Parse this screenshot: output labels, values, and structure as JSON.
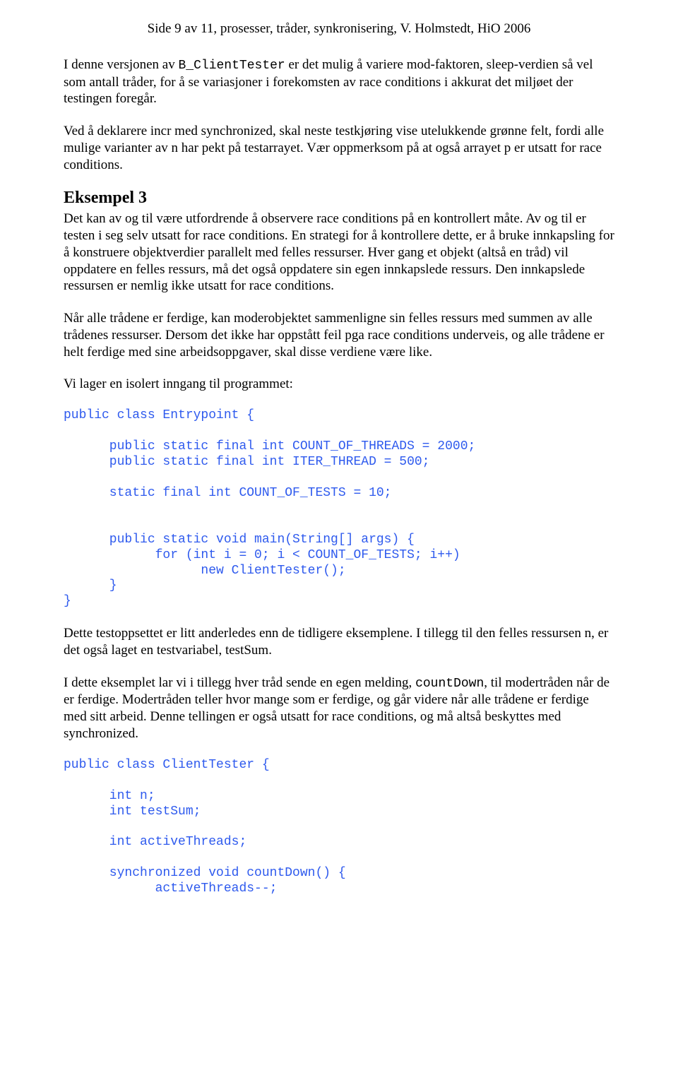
{
  "header": "Side 9 av 11, prosesser, tråder, synkronisering, V. Holmstedt, HiO 2006",
  "para1_a": "I denne versjonen av ",
  "para1_code": "B_ClientTester",
  "para1_b": " er det mulig å variere mod-faktoren, sleep-verdien så vel som antall tråder, for å se variasjoner i forekomsten av race conditions i akkurat det miljøet der testingen foregår.",
  "para2": "Ved å deklarere incr med synchronized, skal neste testkjøring vise utelukkende grønne felt, fordi alle mulige varianter av n har pekt på testarrayet. Vær oppmerksom på at også arrayet p er utsatt for race conditions.",
  "heading_ex3": "Eksempel 3",
  "para3": "Det kan av og til være utfordrende å observere race conditions på en kontrollert måte. Av og til er testen i seg selv utsatt for race conditions. En strategi for å kontrollere dette, er å bruke innkapsling for å konstruere objektverdier parallelt med felles ressurser. Hver gang et objekt (altså en tråd) vil oppdatere en felles ressurs, må det også oppdatere sin egen innkapslede ressurs. Den innkapslede ressursen er nemlig ikke utsatt for race conditions.",
  "para4": "Når alle trådene er ferdige, kan moderobjektet sammenligne sin felles ressurs med summen av alle trådenes ressurser. Dersom det ikke har oppstått feil pga race conditions underveis, og alle trådene er helt ferdige med sine arbeidsoppgaver, skal disse verdiene være like.",
  "para5": "Vi lager en isolert inngang til programmet:",
  "code1": "public class Entrypoint {\n\n      public static final int COUNT_OF_THREADS = 2000;\n      public static final int ITER_THREAD = 500;\n\n      static final int COUNT_OF_TESTS = 10;\n\n\n      public static void main(String[] args) {\n            for (int i = 0; i < COUNT_OF_TESTS; i++)\n                  new ClientTester();\n      }\n}",
  "para6": "Dette testoppsettet er litt anderledes enn de tidligere eksemplene. I tillegg til den felles ressursen n, er det også laget en testvariabel, testSum.",
  "para7_a": "I dette eksemplet lar vi i tillegg hver tråd sende en egen melding, ",
  "para7_code": "countDown",
  "para7_b": ", til modertråden når de er ferdige. Modertråden teller hvor mange som er ferdige, og går videre når alle trådene er ferdige med sitt arbeid. Denne tellingen er også utsatt for race conditions, og må altså beskyttes med synchronized.",
  "code2": "public class ClientTester {\n\n      int n;\n      int testSum;\n\n      int activeThreads;\n\n      synchronized void countDown() {\n            activeThreads--;"
}
